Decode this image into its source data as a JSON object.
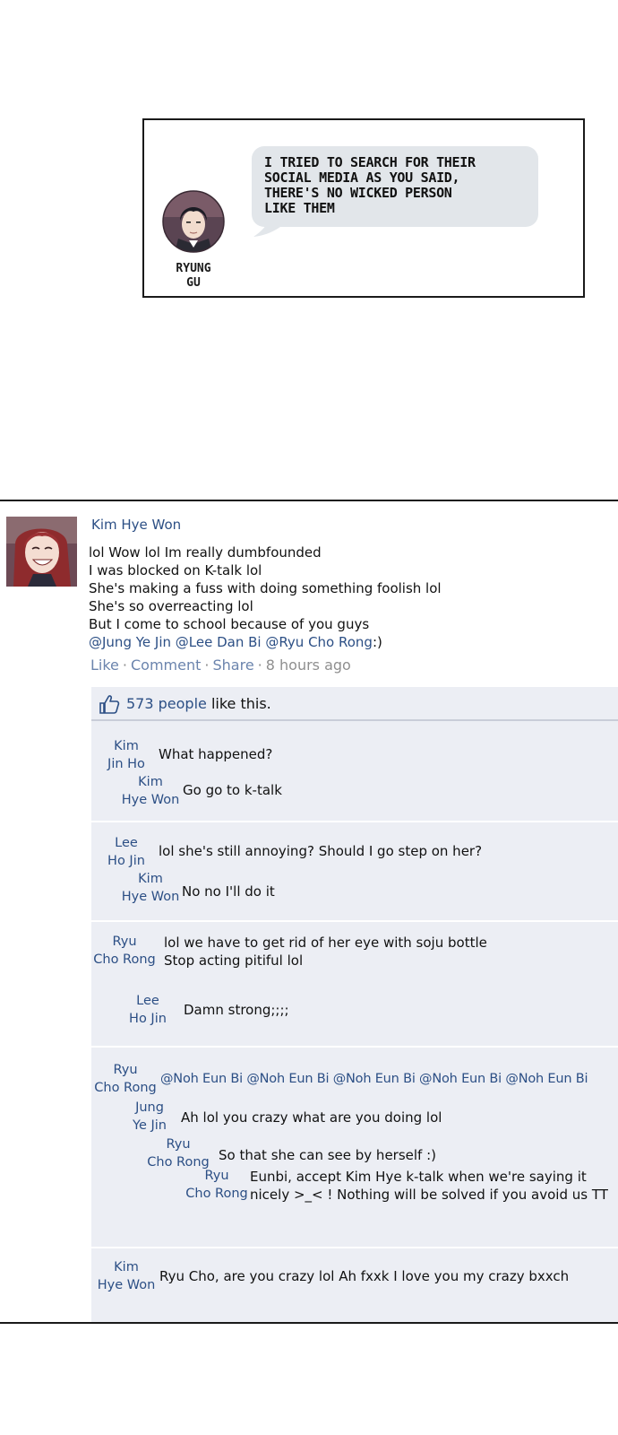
{
  "dialog": {
    "speech": "I tried to search for their social media as you said, there's no wicked person like them",
    "speech_lines": [
      "I TRIED TO SEARCH FOR THEIR",
      "SOCIAL MEDIA AS YOU SAID,",
      "THERE'S NO WICKED PERSON",
      "LIKE THEM"
    ],
    "speaker_lines": [
      "RYUNG",
      "GU"
    ]
  },
  "post": {
    "author": "Kim Hye Won",
    "lines": [
      "lol Wow lol Im really dumbfounded",
      "I was blocked on K-talk lol",
      "She's making a fuss with doing something foolish lol",
      "She's so overreacting lol",
      "But I come to school because of you guys"
    ],
    "mentions": "@Jung Ye Jin @Lee Dan Bi @Ryu Cho Rong",
    "mentions_suffix": ":)",
    "actions": {
      "like": "Like",
      "comment": "Comment",
      "share": "Share",
      "sep": "·",
      "time": "8 hours ago"
    },
    "likes": {
      "count": "573 people",
      "suffix": "like this."
    }
  },
  "comments": [
    {
      "name": [
        "Kim",
        "Jin Ho"
      ],
      "text": [
        "What happened?"
      ]
    },
    {
      "name": [
        "Kim",
        "Hye Won"
      ],
      "text": [
        "Go go to k-talk"
      ]
    },
    {
      "name": [
        "Lee",
        "Ho Jin"
      ],
      "text": [
        "lol she's still annoying? Should I go step on her?"
      ]
    },
    {
      "name": [
        "Kim",
        "Hye Won"
      ],
      "text": [
        "No no I'll do it"
      ]
    },
    {
      "name": [
        "Ryu",
        "Cho Rong"
      ],
      "text": [
        "lol we have to get rid of her eye with soju bottle",
        "Stop acting pitiful lol"
      ]
    },
    {
      "name": [
        "Lee",
        "Ho Jin"
      ],
      "text": [
        "Damn strong;;;;"
      ]
    },
    {
      "name": [
        "Ryu",
        "Cho Rong"
      ],
      "text": [
        "@Noh Eun Bi @Noh Eun Bi @Noh Eun Bi @Noh Eun Bi @Noh Eun Bi"
      ]
    },
    {
      "name": [
        "Jung",
        "Ye Jin"
      ],
      "text": [
        "Ah lol you crazy what are you doing lol"
      ]
    },
    {
      "name": [
        "Ryu",
        "Cho Rong"
      ],
      "text": [
        "So that she can see by herself :)"
      ]
    },
    {
      "name": [
        "Ryu",
        "Cho Rong"
      ],
      "text": [
        "Eunbi, accept Kim Hye k-talk when we're saying it",
        "nicely >_< ! Nothing will be solved if you avoid us TT"
      ]
    },
    {
      "name": [
        "Kim",
        "Hye Won"
      ],
      "text": [
        "Ryu Cho, are you crazy lol Ah fxxk I love you my crazy bxxch"
      ]
    }
  ],
  "colors": {
    "link_blue": "#2c4f85",
    "comment_bg": "#eceef4",
    "bubble_bg": "#e2e6ea",
    "action_blue": "#6b84ad"
  }
}
